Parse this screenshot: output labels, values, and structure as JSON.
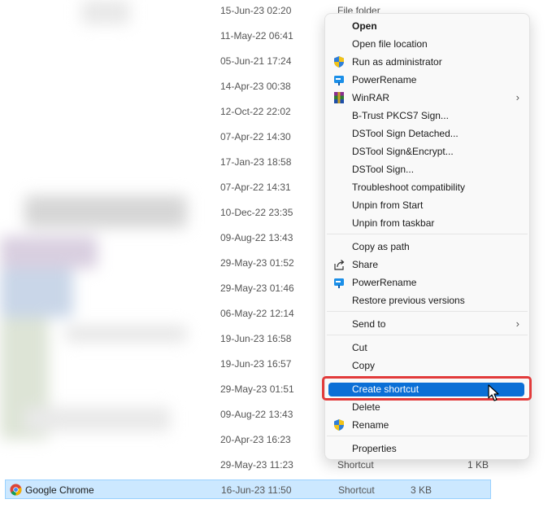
{
  "file_list": {
    "rows": [
      {
        "date": "15-Jun-23 02:20",
        "type": "File folder",
        "size": ""
      },
      {
        "date": "11-May-22 06:41",
        "type": "",
        "size": ""
      },
      {
        "date": "05-Jun-21 17:24",
        "type": "",
        "size": ""
      },
      {
        "date": "14-Apr-23 00:38",
        "type": "",
        "size": ""
      },
      {
        "date": "12-Oct-22 22:02",
        "type": "",
        "size": ""
      },
      {
        "date": "07-Apr-22 14:30",
        "type": "",
        "size": ""
      },
      {
        "date": "17-Jan-23 18:58",
        "type": "",
        "size": ""
      },
      {
        "date": "07-Apr-22 14:31",
        "type": "",
        "size": ""
      },
      {
        "date": "10-Dec-22 23:35",
        "type": "",
        "size": ""
      },
      {
        "date": "09-Aug-22 13:43",
        "type": "",
        "size": ""
      },
      {
        "date": "29-May-23 01:52",
        "type": "",
        "size": ""
      },
      {
        "date": "29-May-23 01:46",
        "type": "",
        "size": ""
      },
      {
        "date": "06-May-22 12:14",
        "type": "",
        "size": ""
      },
      {
        "date": "19-Jun-23 16:58",
        "type": "",
        "size": ""
      },
      {
        "date": "19-Jun-23 16:57",
        "type": "",
        "size": ""
      },
      {
        "date": "29-May-23 01:51",
        "type": "",
        "size": ""
      },
      {
        "date": "09-Aug-22 13:43",
        "type": "",
        "size": ""
      },
      {
        "date": "20-Apr-23 16:23",
        "type": "",
        "size": ""
      },
      {
        "date": "29-May-23 11:23",
        "type": "Shortcut",
        "size": "1 KB"
      }
    ],
    "selected": {
      "name": "Google Chrome",
      "date": "16-Jun-23 11:50",
      "type": "Shortcut",
      "size": "3 KB"
    }
  },
  "context_menu": {
    "open": "Open",
    "open_file_location": "Open file location",
    "run_as_admin": "Run as administrator",
    "power_rename_1": "PowerRename",
    "winrar": "WinRAR",
    "btrust": "B-Trust PKCS7 Sign...",
    "dstool_detached": "DSTool Sign Detached...",
    "dstool_encrypt": "DSTool Sign&Encrypt...",
    "dstool_sign": "DSTool Sign...",
    "troubleshoot": "Troubleshoot compatibility",
    "unpin_start": "Unpin from Start",
    "unpin_taskbar": "Unpin from taskbar",
    "copy_as_path": "Copy as path",
    "share": "Share",
    "power_rename_2": "PowerRename",
    "restore_versions": "Restore previous versions",
    "send_to": "Send to",
    "cut": "Cut",
    "copy": "Copy",
    "create_shortcut": "Create shortcut",
    "delete": "Delete",
    "rename": "Rename",
    "properties": "Properties"
  },
  "colors": {
    "highlight": "#0b6fd6",
    "annotation_box": "#e23b3b",
    "selection_bg": "#cce8ff"
  }
}
